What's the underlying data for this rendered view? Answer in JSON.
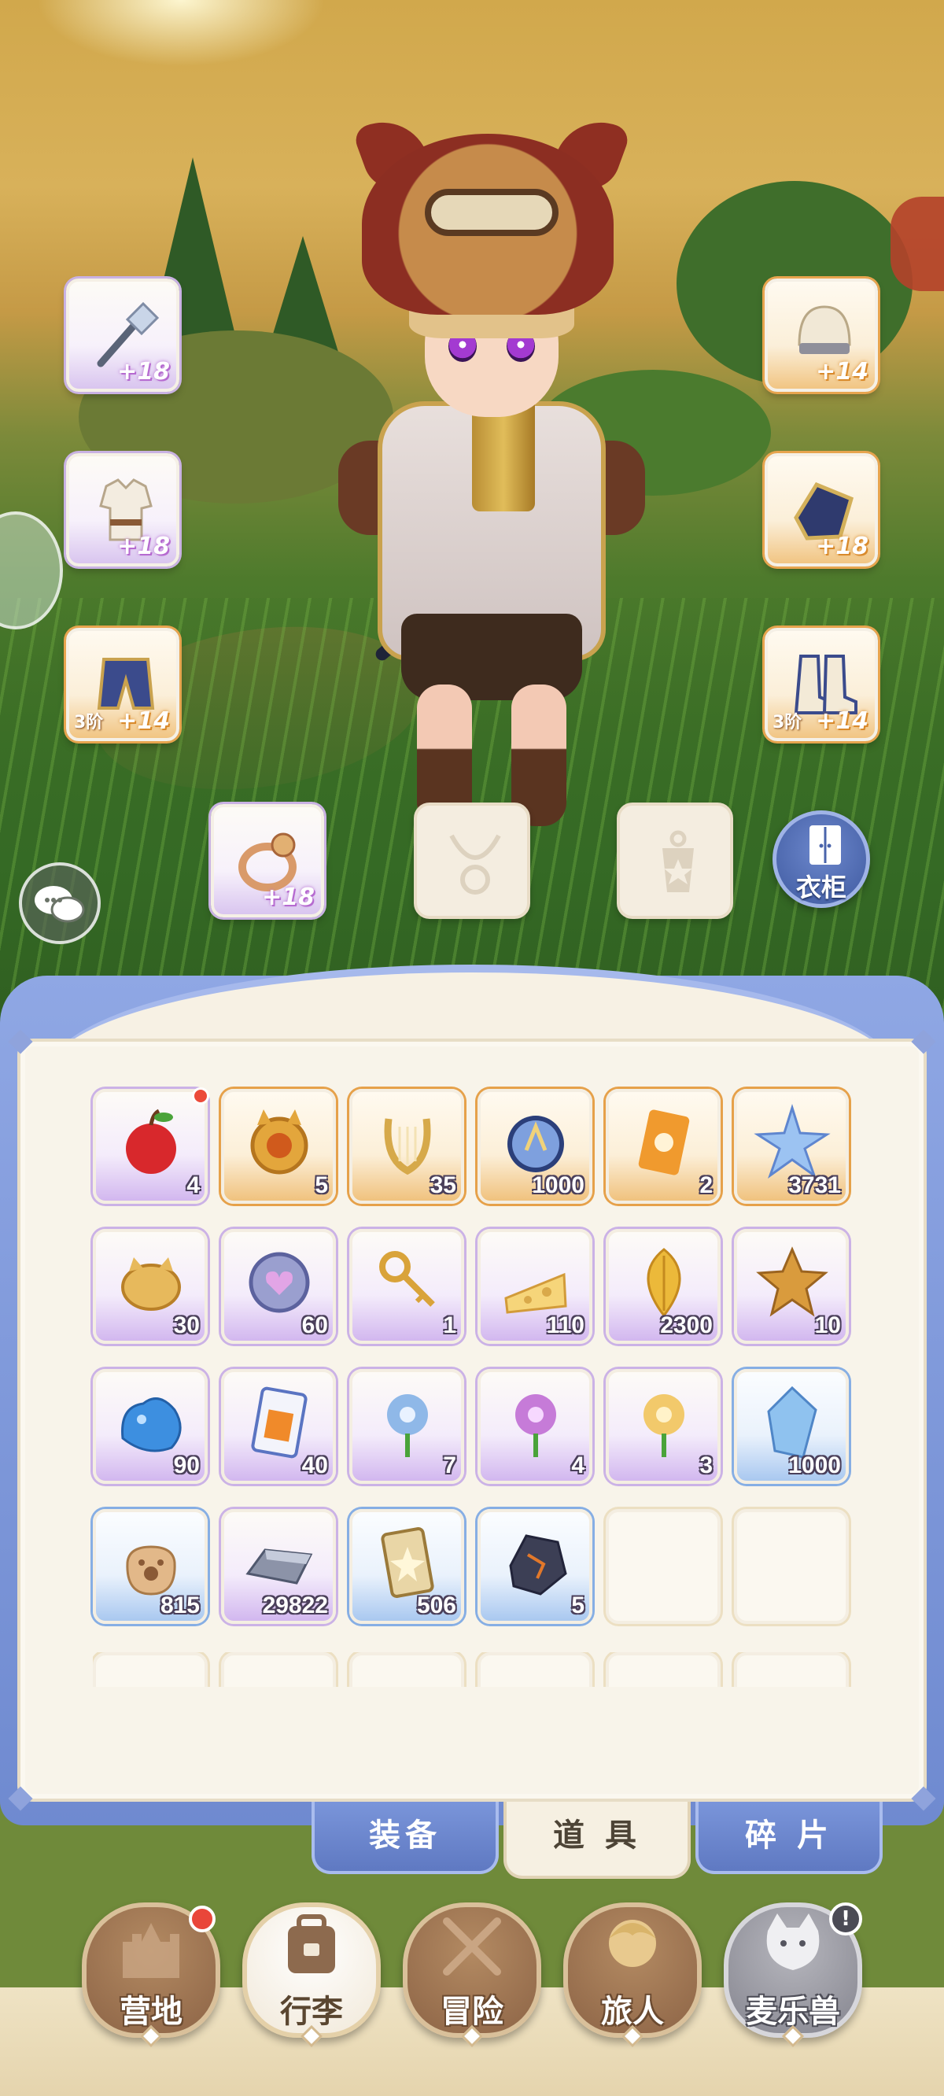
{
  "equipment": {
    "weapon": {
      "plus": "+18",
      "icon": "staff-icon"
    },
    "helmet": {
      "plus": "+14",
      "icon": "helmet-icon"
    },
    "armor": {
      "plus": "+18",
      "icon": "armor-icon"
    },
    "gloves": {
      "plus": "+18",
      "icon": "gauntlet-icon"
    },
    "pants": {
      "tier": "3阶",
      "plus": "+14",
      "icon": "pants-icon"
    },
    "boots": {
      "tier": "3阶",
      "plus": "+14",
      "icon": "boots-icon"
    },
    "ring": {
      "plus": "+18",
      "icon": "ring-icon"
    },
    "necklace_empty": {
      "icon": "necklace-icon"
    },
    "charm_empty": {
      "icon": "charm-icon"
    }
  },
  "wardrobe": {
    "label": "衣柜",
    "icon": "wardrobe-icon"
  },
  "inventory": {
    "items": [
      {
        "name": "apple",
        "count": "4",
        "rarity": "purple",
        "new": true
      },
      {
        "name": "gold-cat-coin",
        "count": "5",
        "rarity": "orange"
      },
      {
        "name": "lyre",
        "count": "35",
        "rarity": "orange"
      },
      {
        "name": "crystal-orb",
        "count": "1000",
        "rarity": "orange"
      },
      {
        "name": "orange-card",
        "count": "2",
        "rarity": "orange"
      },
      {
        "name": "star-crystal",
        "count": "3731",
        "rarity": "orange"
      },
      {
        "name": "cat-cookie",
        "count": "30",
        "rarity": "purple"
      },
      {
        "name": "heart-coin",
        "count": "60",
        "rarity": "purple"
      },
      {
        "name": "golden-key",
        "count": "1",
        "rarity": "purple"
      },
      {
        "name": "cheese",
        "count": "110",
        "rarity": "purple"
      },
      {
        "name": "golden-leaf",
        "count": "2300",
        "rarity": "purple"
      },
      {
        "name": "star-cookie",
        "count": "10",
        "rarity": "purple"
      },
      {
        "name": "blue-slime",
        "count": "90",
        "rarity": "purple"
      },
      {
        "name": "ticket",
        "count": "40",
        "rarity": "purple"
      },
      {
        "name": "blue-flower",
        "count": "7",
        "rarity": "purple"
      },
      {
        "name": "purple-flower",
        "count": "4",
        "rarity": "purple"
      },
      {
        "name": "yellow-flower",
        "count": "3",
        "rarity": "purple"
      },
      {
        "name": "blue-gem",
        "count": "1000",
        "rarity": "blue"
      },
      {
        "name": "paw-bag",
        "count": "815",
        "rarity": "blue"
      },
      {
        "name": "iron-ingot",
        "count": "29822",
        "rarity": "purple"
      },
      {
        "name": "star-card",
        "count": "506",
        "rarity": "blue"
      },
      {
        "name": "dark-ore",
        "count": "5",
        "rarity": "blue"
      }
    ],
    "empty_slots_in_last_row": 2
  },
  "tabs": [
    {
      "label": "装备",
      "active": false
    },
    {
      "label": "道 具",
      "active": true
    },
    {
      "label": "碎 片",
      "active": false
    }
  ],
  "nav": [
    {
      "label": "营地",
      "icon": "castle-icon",
      "badge": true
    },
    {
      "label": "行李",
      "icon": "backpack-icon",
      "active": true
    },
    {
      "label": "冒险",
      "icon": "crossed-swords-icon"
    },
    {
      "label": "旅人",
      "icon": "traveler-icon"
    },
    {
      "label": "麦乐兽",
      "icon": "pet-icon",
      "alert": "!"
    }
  ],
  "colors": {
    "purple_rarity": "#cbb2e6",
    "orange_rarity": "#e6a14a",
    "blue_rarity": "#86aee4",
    "panel_blue": "#7a95da",
    "badge_red": "#ec4a3a"
  }
}
